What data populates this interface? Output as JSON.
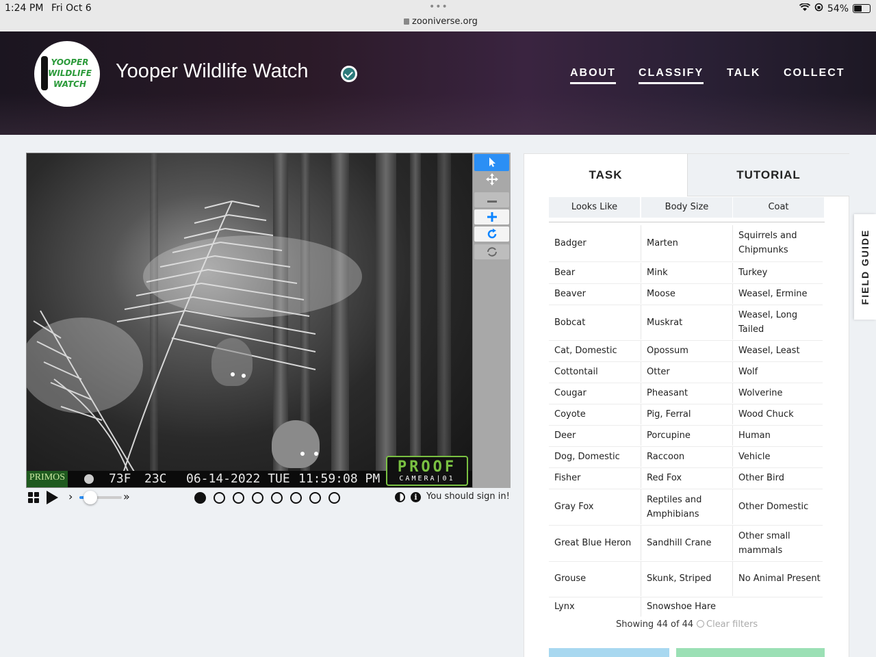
{
  "status_bar": {
    "time": "1:24 PM",
    "date": "Fri Oct 6",
    "dots": "•••",
    "url": "zooniverse.org",
    "battery": "54%",
    "battery_level": 0.54
  },
  "header": {
    "logo_text": [
      "YOOPER",
      "WILDLIFE",
      "WATCH"
    ],
    "title": "Yooper Wildlife Watch",
    "nav": [
      "ABOUT",
      "CLASSIFY",
      "TALK",
      "COLLECT"
    ]
  },
  "viewer": {
    "stamp": {
      "brand": "PRIMOS",
      "temp_f": "73F",
      "temp_c": "23C",
      "date": "06-14-2022 TUE",
      "time": "11:59:08 PM",
      "proof_line1": "PROOF",
      "proof_line2": "CAMERA|01"
    },
    "tools": [
      "pointer-icon",
      "move-icon",
      "zoom-out-icon",
      "zoom-in-icon",
      "rotate-icon",
      "reset-icon"
    ],
    "frames": 8,
    "current_frame": 1,
    "speed_level": 0.25,
    "signin_text": "You should sign in!"
  },
  "panel": {
    "tabs": [
      "TASK",
      "TUTORIAL"
    ],
    "filters": [
      "Looks Like",
      "Body Size",
      "Coat"
    ],
    "rows": [
      [
        "Badger",
        "Marten",
        "Squirrels and Chipmunks"
      ],
      [
        "Bear",
        "Mink",
        "Turkey"
      ],
      [
        "Beaver",
        "Moose",
        "Weasel, Ermine"
      ],
      [
        "Bobcat",
        "Muskrat",
        "Weasel, Long Tailed"
      ],
      [
        "Cat, Domestic",
        "Opossum",
        "Weasel, Least"
      ],
      [
        "Cottontail",
        "Otter",
        "Wolf"
      ],
      [
        "Cougar",
        "Pheasant",
        "Wolverine"
      ],
      [
        "Coyote",
        "Pig, Ferral",
        "Wood Chuck"
      ],
      [
        "Deer",
        "Porcupine",
        "Human"
      ],
      [
        "Dog, Domestic",
        "Raccoon",
        "Vehicle"
      ],
      [
        "Fisher",
        "Red Fox",
        "Other Bird"
      ],
      [
        "Gray Fox",
        "Reptiles and Amphibians",
        "Other Domestic"
      ],
      [
        "Great Blue Heron",
        "Sandhill Crane",
        "Other small mammals"
      ],
      [
        "Grouse",
        "Skunk, Striped",
        "No Animal Present"
      ],
      [
        "Lynx",
        "Snowshoe Hare",
        ""
      ]
    ],
    "showing": "Showing 44 of 44",
    "clear_filters": "Clear filters"
  },
  "field_guide": "FIELD GUIDE"
}
